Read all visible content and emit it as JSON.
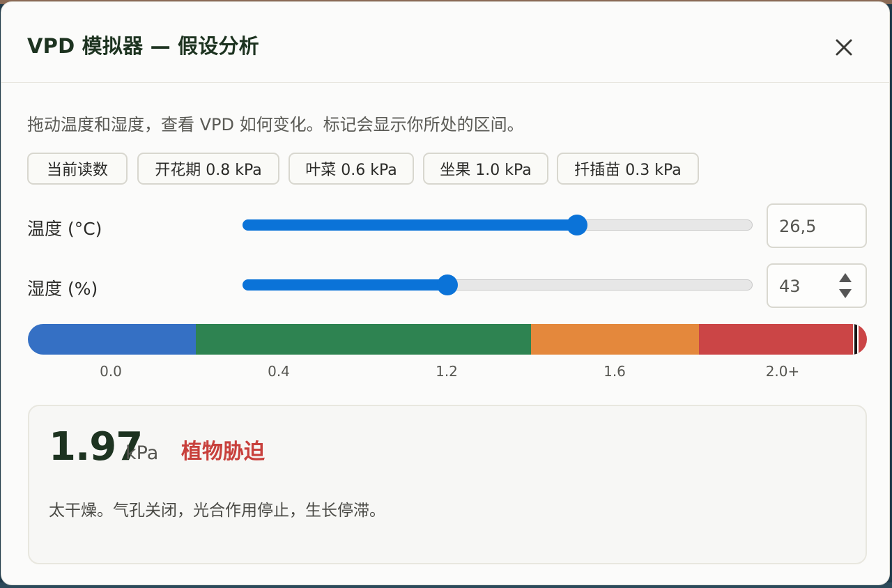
{
  "dialog": {
    "title": "VPD 模拟器 — 假设分析",
    "close_label": "×"
  },
  "intro": "拖动温度和湿度，查看 VPD 如何变化。标记会显示你所处的区间。",
  "presets": [
    {
      "label": "当前读数"
    },
    {
      "label": "开花期 0.8 kPa"
    },
    {
      "label": "叶菜 0.6 kPa"
    },
    {
      "label": "坐果 1.0 kPa"
    },
    {
      "label": "扦插苗 0.3 kPa"
    }
  ],
  "temperature": {
    "label": "温度 (°C)",
    "value_display": "26,5",
    "slider_fraction": 0.654
  },
  "humidity": {
    "label": "湿度 (%)",
    "value_display": "43",
    "slider_fraction": 0.4
  },
  "scale": {
    "segments": [
      {
        "name": "blue",
        "color": "#3570c4"
      },
      {
        "name": "green",
        "color": "#2e8351"
      },
      {
        "name": "orange",
        "color": "#e4883c"
      },
      {
        "name": "red",
        "color": "#cb4546"
      }
    ],
    "ticks": [
      "0.0",
      "0.4",
      "1.2",
      "1.6",
      "2.0+"
    ],
    "marker_fraction": 0.985
  },
  "result": {
    "value": "1.97",
    "unit": "kPa",
    "status": "植物胁迫",
    "status_color": "#c8403c",
    "description": "太干燥。气孔关闭，光合作用停止，生长停滞。"
  }
}
